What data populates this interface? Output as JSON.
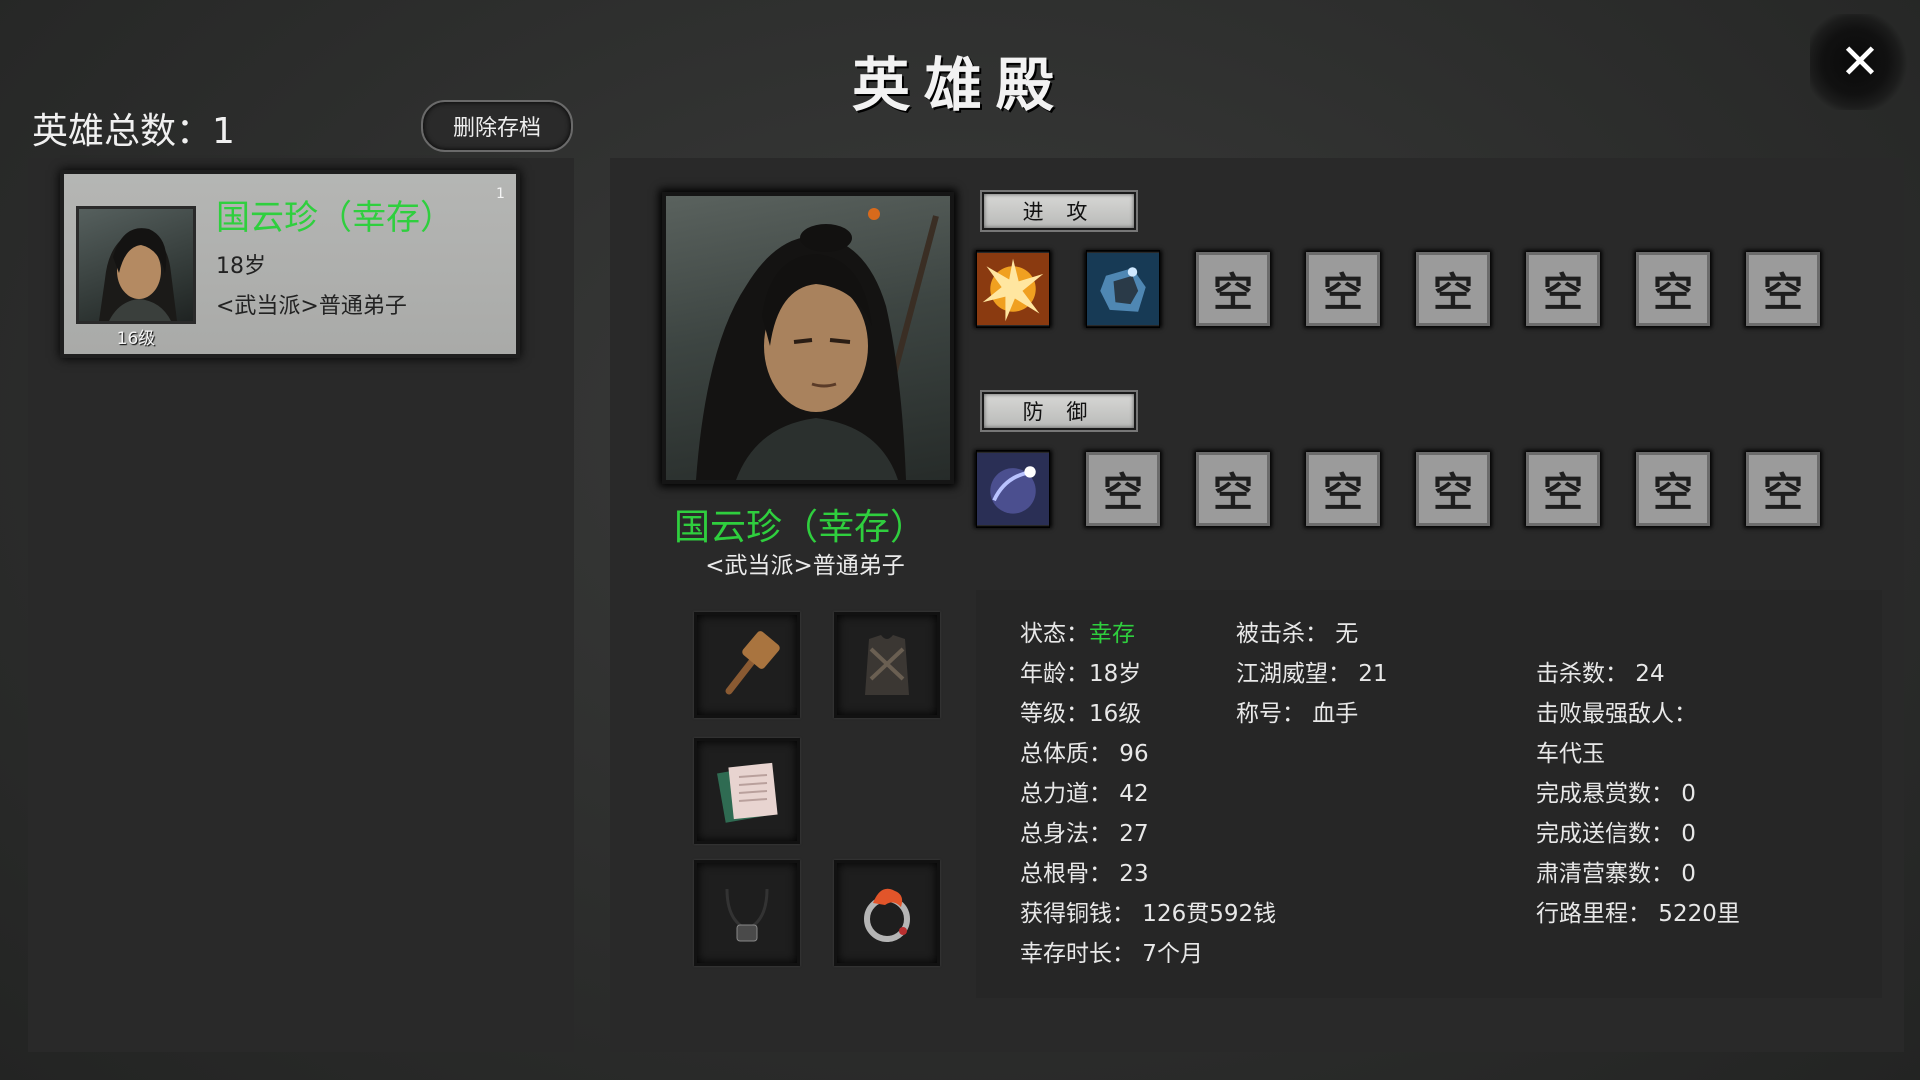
{
  "title": "英雄殿",
  "close_icon": "close-x-icon",
  "hero_count": {
    "label": "英雄总数：",
    "value": "1"
  },
  "delete_button": "删除存档",
  "hero_list": [
    {
      "index": "1",
      "name": "国云珍（幸存）",
      "age": "18岁",
      "sect": "<武当派>普通弟子",
      "level": "16级"
    }
  ],
  "hero": {
    "name": "国云珍（幸存）",
    "sect": "<武当派>普通弟子"
  },
  "skills": {
    "attack_label": "进 攻",
    "defense_label": "防 御",
    "empty_label": "空",
    "attack_icons": [
      "burst-skill-icon",
      "ice-block-skill-icon"
    ],
    "defense_icons": [
      "dark-orb-skill-icon"
    ],
    "attack_empty_count": 6,
    "defense_empty_count": 7
  },
  "equipment": [
    "wooden-hammer-icon",
    "armor-vest-icon",
    "scroll-book-icon",
    "pendant-necklace-icon",
    "flame-ring-icon"
  ],
  "stats": {
    "status_label": "状态：",
    "status_value": "幸存",
    "age": "年龄：18岁",
    "level": "等级：16级",
    "constitution": "总体质：  96",
    "strength": "总力道：  42",
    "agility": "总身法：  27",
    "root": "总根骨：  23",
    "coins": "获得铜钱：  126贯592钱",
    "survival": "幸存时长：  7个月",
    "killed_by": "被击杀：  无",
    "prestige": "江湖威望：  21",
    "nickname": "称号：  血手",
    "kills": "击杀数：  24",
    "strongest_label": "击败最强敌人：",
    "strongest_value": "车代玉",
    "bounties": "完成悬赏数：   0",
    "letters": "完成送信数：   0",
    "camps": "肃清营寨数：   0",
    "distance": "行路里程：    5220里"
  }
}
